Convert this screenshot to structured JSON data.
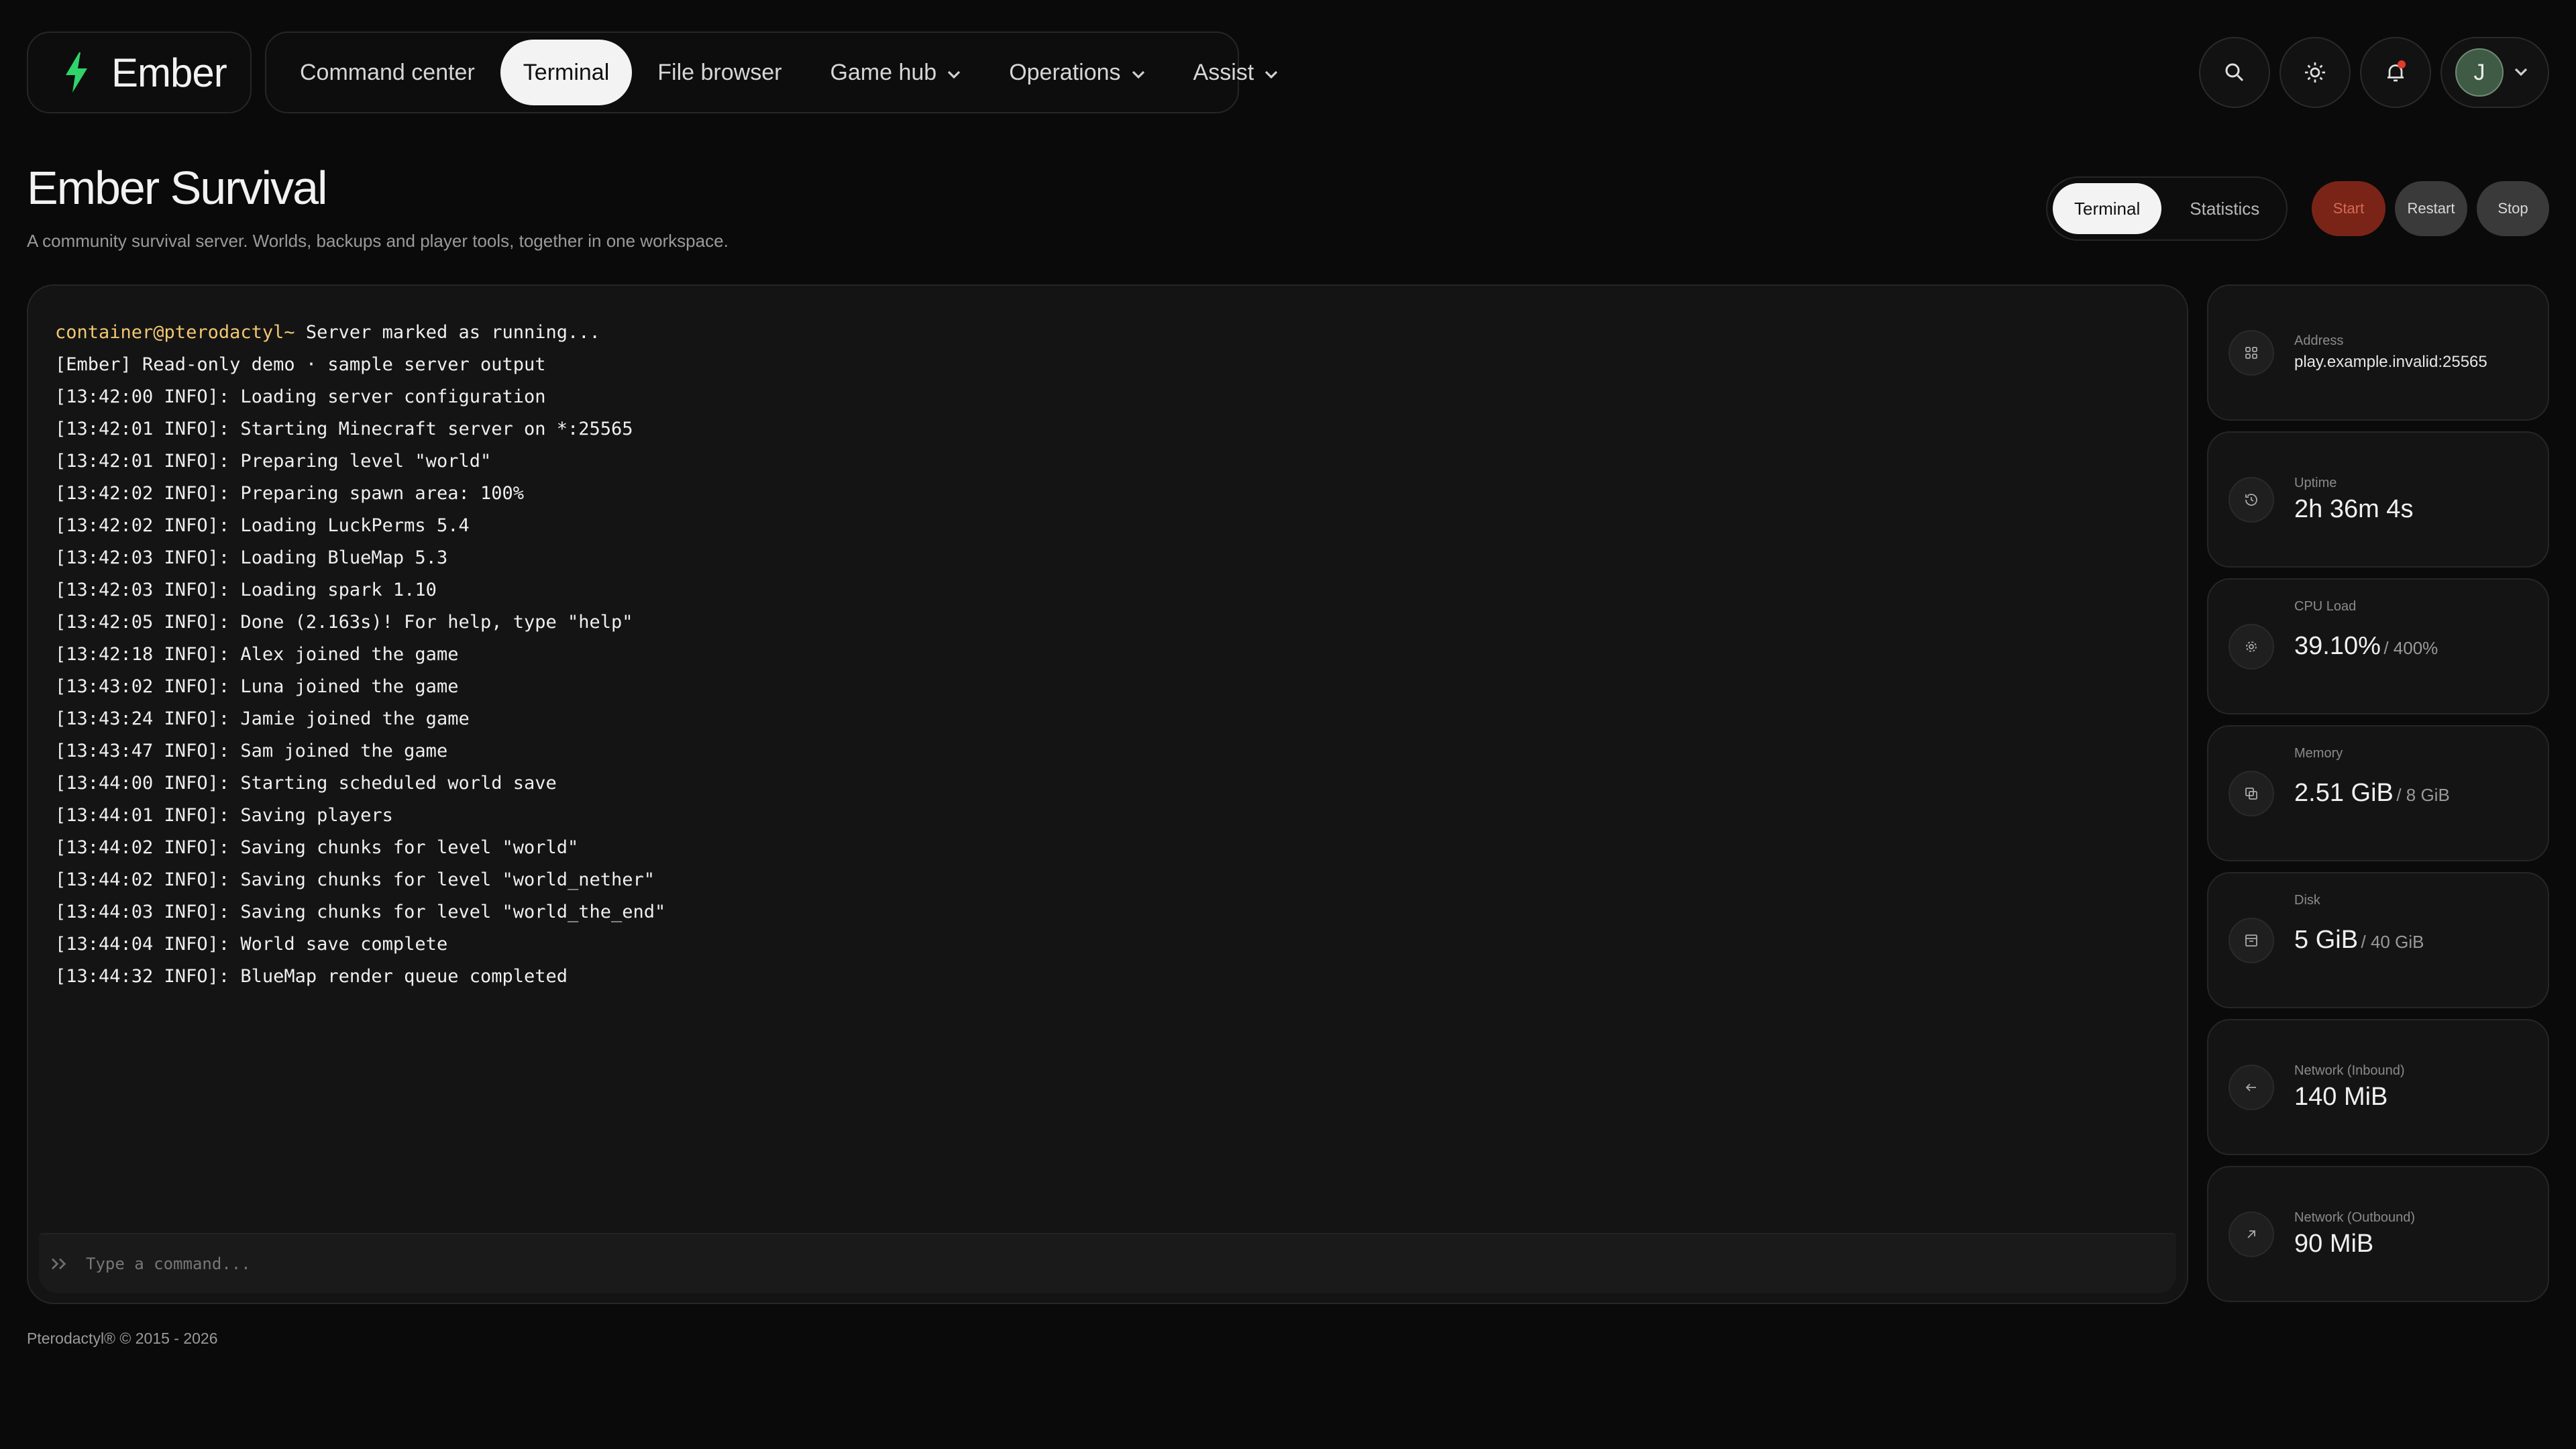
{
  "brand": {
    "name": "Ember"
  },
  "nav": {
    "items": [
      {
        "label": "Command center",
        "dropdown": false,
        "active": false
      },
      {
        "label": "Terminal",
        "dropdown": false,
        "active": true
      },
      {
        "label": "File browser",
        "dropdown": false,
        "active": false
      },
      {
        "label": "Game hub",
        "dropdown": true,
        "active": false
      },
      {
        "label": "Operations",
        "dropdown": true,
        "active": false
      },
      {
        "label": "Assist",
        "dropdown": true,
        "active": false
      }
    ]
  },
  "toolbar": {
    "icons": [
      "search-icon",
      "sun-icon",
      "bell-icon"
    ],
    "user_initial": "J"
  },
  "page": {
    "title": "Ember Survival",
    "subtitle": "A community survival server. Worlds, backups and player tools, together in one workspace."
  },
  "view_toggle": {
    "terminal": "Terminal",
    "statistics": "Statistics"
  },
  "power": {
    "start": "Start",
    "restart": "Restart",
    "stop": "Stop"
  },
  "console": {
    "prompt_user": "container@pterodactyl~",
    "prompt_text": " Server marked as running...",
    "lines": [
      "[Ember] Read-only demo · sample server output",
      "[13:42:00 INFO]: Loading server configuration",
      "[13:42:01 INFO]: Starting Minecraft server on *:25565",
      "[13:42:01 INFO]: Preparing level \"world\"",
      "[13:42:02 INFO]: Preparing spawn area: 100%",
      "[13:42:02 INFO]: Loading LuckPerms 5.4",
      "[13:42:03 INFO]: Loading BlueMap 5.3",
      "[13:42:03 INFO]: Loading spark 1.10",
      "[13:42:05 INFO]: Done (2.163s)! For help, type \"help\"",
      "[13:42:18 INFO]: Alex joined the game",
      "[13:43:02 INFO]: Luna joined the game",
      "[13:43:24 INFO]: Jamie joined the game",
      "[13:43:47 INFO]: Sam joined the game",
      "[13:44:00 INFO]: Starting scheduled world save",
      "[13:44:01 INFO]: Saving players",
      "[13:44:02 INFO]: Saving chunks for level \"world\"",
      "[13:44:02 INFO]: Saving chunks for level \"world_nether\"",
      "[13:44:03 INFO]: Saving chunks for level \"world_the_end\"",
      "[13:44:04 INFO]: World save complete",
      "[13:44:32 INFO]: BlueMap render queue completed"
    ],
    "command_placeholder": "Type a command..."
  },
  "stats": [
    {
      "icon": "address-icon",
      "label": "Address",
      "value": "play.example.invalid:25565",
      "limit": ""
    },
    {
      "icon": "clock-icon",
      "label": "Uptime",
      "value": "2h 36m 4s",
      "limit": ""
    },
    {
      "icon": "cpu-icon",
      "label": "CPU Load",
      "value": "39.10%",
      "limit": "/ 400%"
    },
    {
      "icon": "memory-icon",
      "label": "Memory",
      "value": "2.51 GiB",
      "limit": "/ 8 GiB"
    },
    {
      "icon": "disk-icon",
      "label": "Disk",
      "value": "5 GiB",
      "limit": "/ 40 GiB"
    },
    {
      "icon": "arrow-left-icon",
      "label": "Network (Inbound)",
      "value": "140 MiB",
      "limit": ""
    },
    {
      "icon": "arrow-up-right-icon",
      "label": "Network (Outbound)",
      "value": "90 MiB",
      "limit": ""
    }
  ],
  "footer": {
    "text": "Pterodactyl® © 2015 - 2026"
  },
  "colors": {
    "accent_green": "#2fd46b",
    "prompt_yellow": "#f2c770",
    "start_red": "#7a2418"
  }
}
